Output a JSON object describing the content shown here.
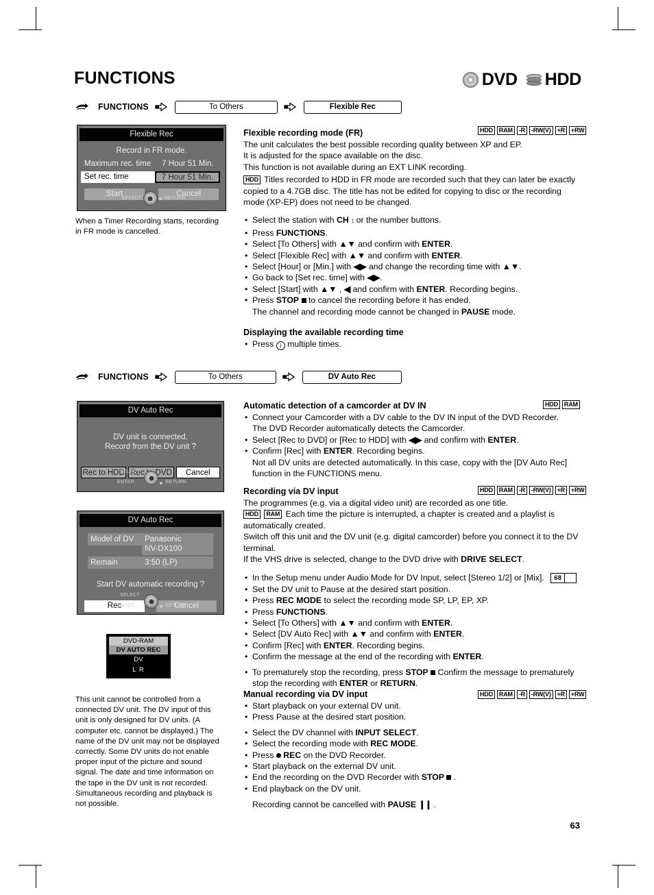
{
  "page": {
    "title": "FUNCTIONS",
    "number": "63",
    "logos": [
      {
        "icon": "dvd-disc-icon",
        "label": "DVD"
      },
      {
        "icon": "hdd-stack-icon",
        "label": "HDD"
      }
    ]
  },
  "section1": {
    "breadcrumb": {
      "hand_icon": "pointing-hand-icon",
      "root": "FUNCTIONS",
      "arrow_icon": "arrow-right-icon",
      "step1": "To Others",
      "step2": "Flexible Rec"
    },
    "osd": {
      "title": "Flexible Rec",
      "message": "Record in FR mode.",
      "row_max_label": "Maximum rec. time",
      "row_max_value": "7 Hour 51 Min.",
      "row_set_label": "Set rec. time",
      "row_set_value": "7 Hour 51 Min.",
      "btn_start": "Start",
      "btn_cancel": "Cancel",
      "jog_select": "SELECT",
      "jog_return": "RETURN"
    },
    "caption": "When a Timer Recording starts, recording in FR mode is cancelled.",
    "badges": [
      "HDD",
      "RAM",
      "-R",
      "-RW(V)",
      "+R",
      "+RW"
    ],
    "heading": "Flexible recording mode (FR)",
    "paragraphs": [
      "The unit calculates the best possible recording quality between XP and EP.",
      "It is adjusted for the space available on the disc.",
      "This function is not available during an EXT LINK recording."
    ],
    "note_badge": "HDD",
    "note": "Titles recorded to HDD in FR mode are recorded such that they can later be exactly copied to a 4.7GB disc. The title has not be edited for copying to disc or the recording mode (XP-EP) does not need to be changed.",
    "steps": [
      "Select the station with CH ⇕ or the number buttons.",
      "Press FUNCTIONS.",
      "Select [To Others] with ▲▼ and confirm with ENTER.",
      "Select [Flexible Rec] with ▲▼ and confirm with ENTER.",
      "Select [Hour] or [Min.] with ◀▶ and change the recording time with ▲▼.",
      "Go back to [Set rec. time] with ◀▶.",
      "Select [Start] with ▲▼ , ◀ and confirm with ENTER. Recording begins.",
      "Press STOP ■ to cancel the recording before it has ended.",
      "The channel and recording mode cannot be changed in PAUSE mode."
    ],
    "subheading": "Displaying the available recording time",
    "substep": "Press ⓘ multiple times."
  },
  "section2": {
    "breadcrumb": {
      "hand_icon": "pointing-hand-icon",
      "root": "FUNCTIONS",
      "arrow_icon": "arrow-right-icon",
      "step1": "To Others",
      "step2": "DV Auto Rec"
    },
    "osd1": {
      "title": "DV Auto Rec",
      "message_line1": "DV unit is connected.",
      "message_line2": "Record from the DV unit ?",
      "btn_hdd": "Rec to HDD",
      "btn_dvd": "Rec to DVD",
      "btn_cancel": "Cancel",
      "jog_select": "SELECT",
      "jog_enter": "ENTER",
      "jog_return": "RETURN"
    },
    "osd2": {
      "title": "DV Auto Rec",
      "row_model_label": "Model of DV",
      "row_model_value_line1": "Panasonic",
      "row_model_value_line2": "NV-DX100",
      "row_remain_label": "Remain",
      "row_remain_value": "3:50 (LP)",
      "message": "Start DV automatic recording ?",
      "btn_rec": "Rec",
      "btn_cancel": "Cancel",
      "jog_select": "SELECT",
      "jog_enter": "ENTER",
      "jog_return": "RETURN"
    },
    "vfd": {
      "line1": "DVD-RAM",
      "line2": "DV AUTO REC",
      "line3": "DV",
      "line4": "L R"
    },
    "caption": "This unit cannot be controlled from a connected DV unit. The DV input of this unit is only designed for DV units. (A computer etc. cannot be displayed.) The name of the DV unit may not be displayed correctly. Some DV units do not enable proper input of the picture and sound signal. The date and time information on the tape in the DV unit is not recorded. Simultaneous recording and playback is not possible.",
    "auto": {
      "heading": "Automatic detection of a camcorder at DV IN",
      "badges": [
        "HDD",
        "RAM"
      ],
      "steps": [
        "Connect your Camcorder with a DV cable to the DV IN input of the DVD Recorder.",
        "The  DVD Recorder automatically detects the Camcorder.",
        "Select [Rec to DVD] or [Rec to HDD] with ◀▶ and confirm with ENTER.",
        "Confirm [Rec] with ENTER. Recording begins.",
        "Not all DV units are detected automatically. In this case, copy with the  [DV Auto Rec] function in the  FUNCTIONS  menu."
      ]
    },
    "viadv": {
      "heading": "Recording via DV input",
      "badges": [
        "HDD",
        "RAM",
        "-R",
        "-RW(V)",
        "+R",
        "+RW"
      ],
      "para1": "The programmes (e.g. via a digital video unit) are recorded as one title.",
      "note_badges": [
        "HDD",
        "RAM"
      ],
      "para2": "Each time the picture is interrupted, a chapter is created and a playlist is automatically created.",
      "para3": "Switch off this unit and the DV unit (e.g. digital camcorder) before you connect it to the DV terminal.",
      "para4": "If the VHS drive is selected, change to the DVD drive with DRIVE SELECT.",
      "pageref": "68",
      "steps": [
        "In the Setup menu under Audio Mode for DV Input, select [Stereo 1/2] or [Mix].",
        "Set the DV unit to Pause at the desired start position.",
        "Press REC MODE to select the recording mode SP, LP, EP, XP.",
        "Press FUNCTIONS.",
        "Select [To Others] with ▲▼ and confirm with ENTER.",
        "Select [DV Auto Rec] with ▲▼ and confirm with ENTER.",
        "Confirm [Rec] with ENTER. Recording begins.",
        "Confirm the message at the end of the recording with ENTER.",
        "To prematurely stop the recording, press STOP ■. Confirm the message to prematurely stop the recording with ENTER or RETURN."
      ]
    },
    "manual": {
      "heading": "Manual recording via DV input",
      "badges": [
        "HDD",
        "RAM",
        "-R",
        "-RW(V)",
        "+R",
        "+RW"
      ],
      "steps": [
        "Start playback on your external DV unit.",
        "Press Pause at the desired start position.",
        "Select the DV channel with INPUT SELECT.",
        "Select the recording mode with REC MODE.",
        "Press ● REC on the DVD Recorder.",
        "Start playback on the external DV unit.",
        "End the recording on the DVD Recorder with STOP ■ .",
        "End playback on the DV unit.",
        "Recording cannot be cancelled with PAUSE ❙❙ ."
      ]
    }
  }
}
